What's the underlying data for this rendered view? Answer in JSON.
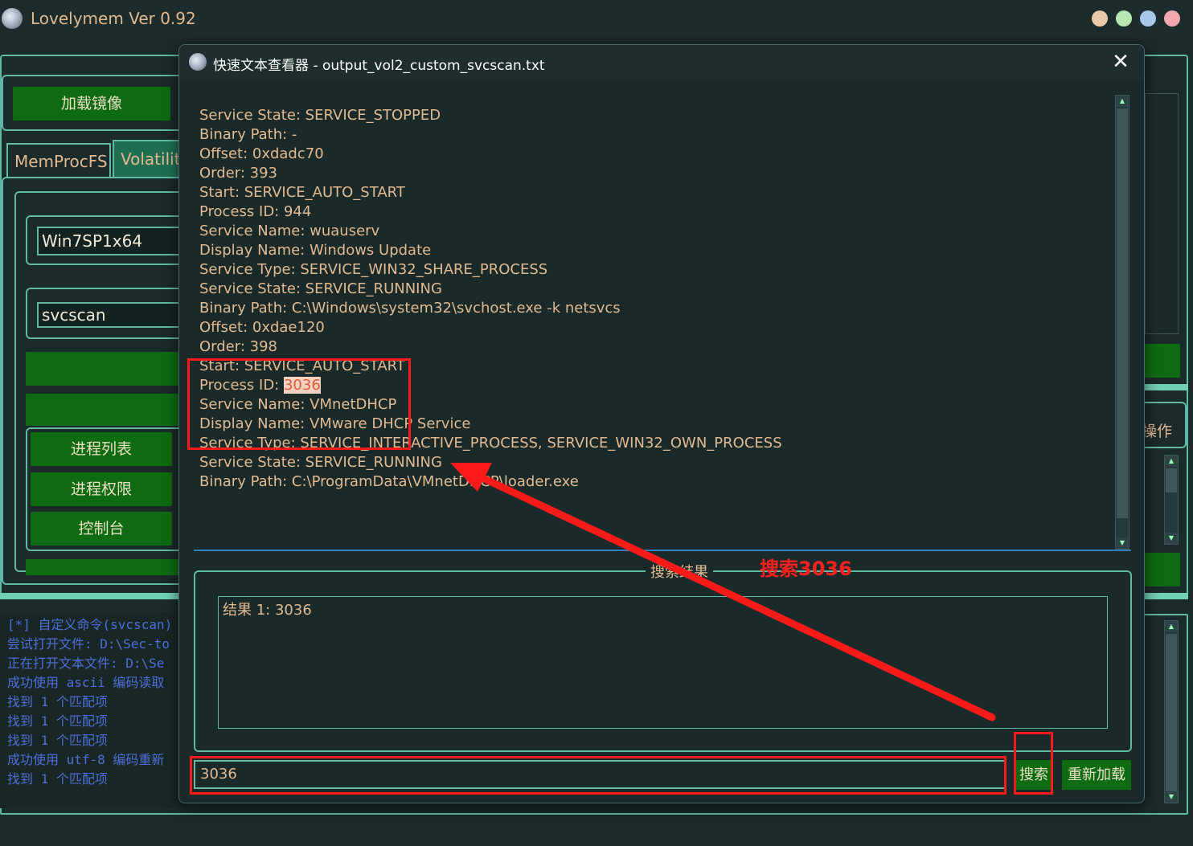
{
  "app": {
    "title": "Lovelymem Ver 0.92",
    "window_dots": [
      "#e8c9a8",
      "#b7e6b0",
      "#a8c8ea",
      "#f0a8ae"
    ]
  },
  "sidebar": {
    "load_image_label": "加载镜像",
    "tabs": [
      {
        "label": "MemProcFS"
      },
      {
        "label": "Volatility"
      }
    ],
    "profile_value": "Win7SP1x64",
    "command_value": "svcscan",
    "buttons": [
      {
        "label": "进程列表"
      },
      {
        "label": "进程权限"
      },
      {
        "label": "控制台"
      }
    ],
    "right_partial_label": "操作"
  },
  "log": {
    "lines": [
      "[*] 自定义命令(svcscan)",
      "尝试打开文件: D:\\Sec-to",
      "正在打开文本文件: D:\\Se",
      "成功使用 ascii 编码读取",
      "找到 1 个匹配项",
      "找到 1 个匹配项",
      "找到 1 个匹配项",
      "成功使用 utf-8 编码重新",
      "找到 1 个匹配项"
    ]
  },
  "dialog": {
    "title": "快速文本查看器 - output_vol2_custom_svcscan.txt",
    "close_symbol": "✕",
    "text_lines": [
      "Service State: SERVICE_STOPPED",
      "Binary Path: -",
      "",
      "Offset: 0xdadc70",
      "Order: 393",
      "Start: SERVICE_AUTO_START",
      "Process ID: 944",
      "Service Name: wuauserv",
      "Display Name: Windows Update",
      "Service Type: SERVICE_WIN32_SHARE_PROCESS",
      "Service State: SERVICE_RUNNING",
      "Binary Path: C:\\Windows\\system32\\svchost.exe -k netsvcs",
      "",
      "Offset: 0xdae120",
      "Order: 398",
      "Start: SERVICE_AUTO_START",
      "Process ID: ",
      "Service Name: VMnetDHCP",
      "Display Name: VMware DHCP Service",
      "Service Type: SERVICE_INTERACTIVE_PROCESS, SERVICE_WIN32_OWN_PROCESS",
      "Service State: SERVICE_RUNNING",
      "Binary Path: C:\\ProgramData\\VMnetDHCP\\loader.exe"
    ],
    "highlight_match": "3036",
    "results_legend": "搜索结果",
    "results": [
      "结果 1: 3036"
    ],
    "search_value": "3036",
    "search_button": "搜索",
    "reload_button": "重新加载"
  },
  "annotation": {
    "label": "搜索3036"
  }
}
